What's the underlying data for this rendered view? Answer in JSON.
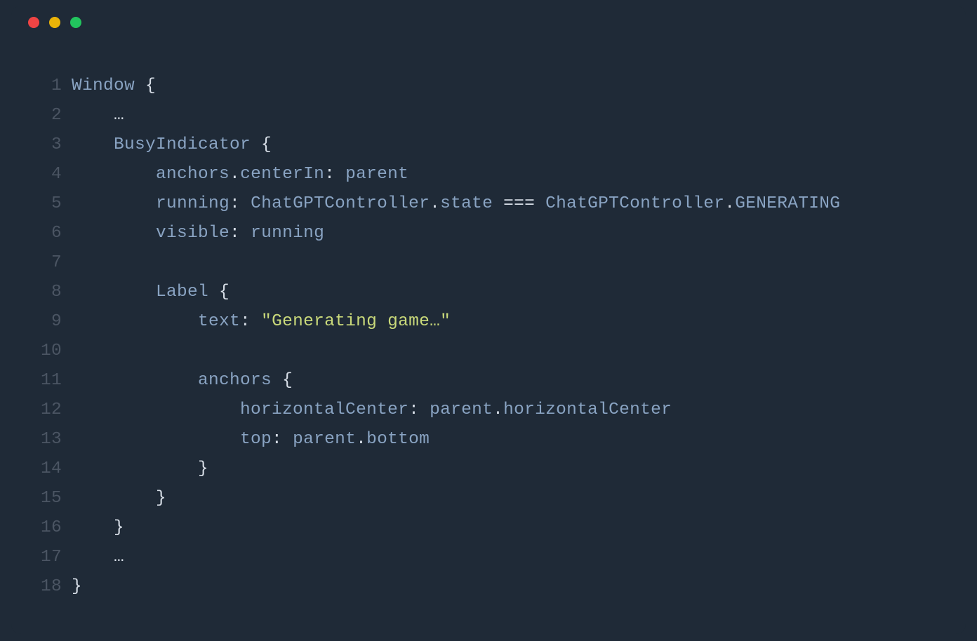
{
  "window": {
    "traffic_lights": {
      "red": "red",
      "yellow": "yellow",
      "green": "green"
    }
  },
  "gutter": {
    "l1": "1",
    "l2": "2",
    "l3": "3",
    "l4": "4",
    "l5": "5",
    "l6": "6",
    "l7": "7",
    "l8": "8",
    "l9": "9",
    "l10": "10",
    "l11": "11",
    "l12": "12",
    "l13": "13",
    "l14": "14",
    "l15": "15",
    "l16": "16",
    "l17": "17",
    "l18": "18"
  },
  "code": {
    "l1": {
      "a": "Window",
      "b": " {"
    },
    "l2": {
      "a": "    ",
      "b": "…"
    },
    "l3": {
      "a": "    ",
      "b": "BusyIndicator",
      "c": " {"
    },
    "l4": {
      "a": "        anchors",
      "b": ".",
      "c": "centerIn",
      "d": ":",
      "e": " parent"
    },
    "l5": {
      "a": "        running",
      "b": ":",
      "c": " ChatGPTController",
      "d": ".",
      "e": "state ",
      "f": "===",
      "g": " ChatGPTController",
      "h": ".",
      "i": "GENERATING"
    },
    "l6": {
      "a": "        visible",
      "b": ":",
      "c": " running"
    },
    "l7": {
      "a": ""
    },
    "l8": {
      "a": "        ",
      "b": "Label",
      "c": " {"
    },
    "l9": {
      "a": "            text",
      "b": ":",
      "c": " ",
      "d": "\"Generating game…\""
    },
    "l10": {
      "a": ""
    },
    "l11": {
      "a": "            anchors ",
      "b": "{"
    },
    "l12": {
      "a": "                horizontalCenter",
      "b": ":",
      "c": " parent",
      "d": ".",
      "e": "horizontalCenter"
    },
    "l13": {
      "a": "                top",
      "b": ":",
      "c": " parent",
      "d": ".",
      "e": "bottom"
    },
    "l14": {
      "a": "            ",
      "b": "}"
    },
    "l15": {
      "a": "        ",
      "b": "}"
    },
    "l16": {
      "a": "    ",
      "b": "}"
    },
    "l17": {
      "a": "    ",
      "b": "…"
    },
    "l18": {
      "a": "}"
    }
  }
}
